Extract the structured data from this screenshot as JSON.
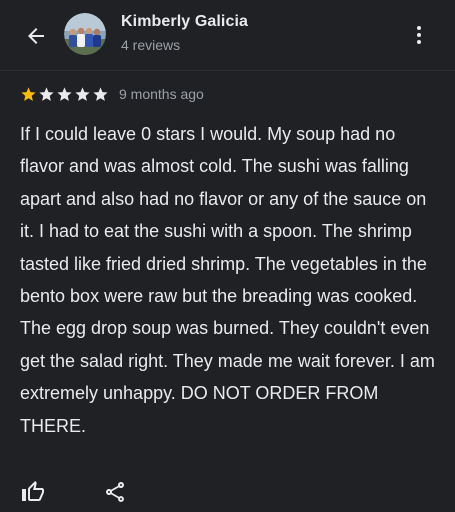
{
  "header": {
    "reviewer_name": "Kimberly Galicia",
    "reviewer_subtitle": "4 reviews",
    "back_icon": "arrow-left-icon",
    "more_icon": "more-vertical-icon"
  },
  "review": {
    "rating": 1,
    "max_rating": 5,
    "time_ago": "9 months ago",
    "text": "If I could leave 0 stars I would. My soup had no flavor and was almost cold. The sushi was falling apart and also had no flavor or any of the sauce on it. I had to eat the sushi with a spoon. The shrimp tasted like fried dried shrimp. The vegetables in the bento box were raw but the breading was cooked. The egg drop soup was burned. They couldn't even get the salad right. They made me wait forever. I am extremely unhappy. DO NOT ORDER FROM THERE."
  },
  "actions": {
    "like_icon": "thumbs-up-icon",
    "share_icon": "share-icon"
  },
  "colors": {
    "background": "#202124",
    "text_primary": "#e8eaed",
    "text_secondary": "#9aa0a6",
    "star_filled": "#fbbc04",
    "star_empty": "#e8eaed"
  }
}
